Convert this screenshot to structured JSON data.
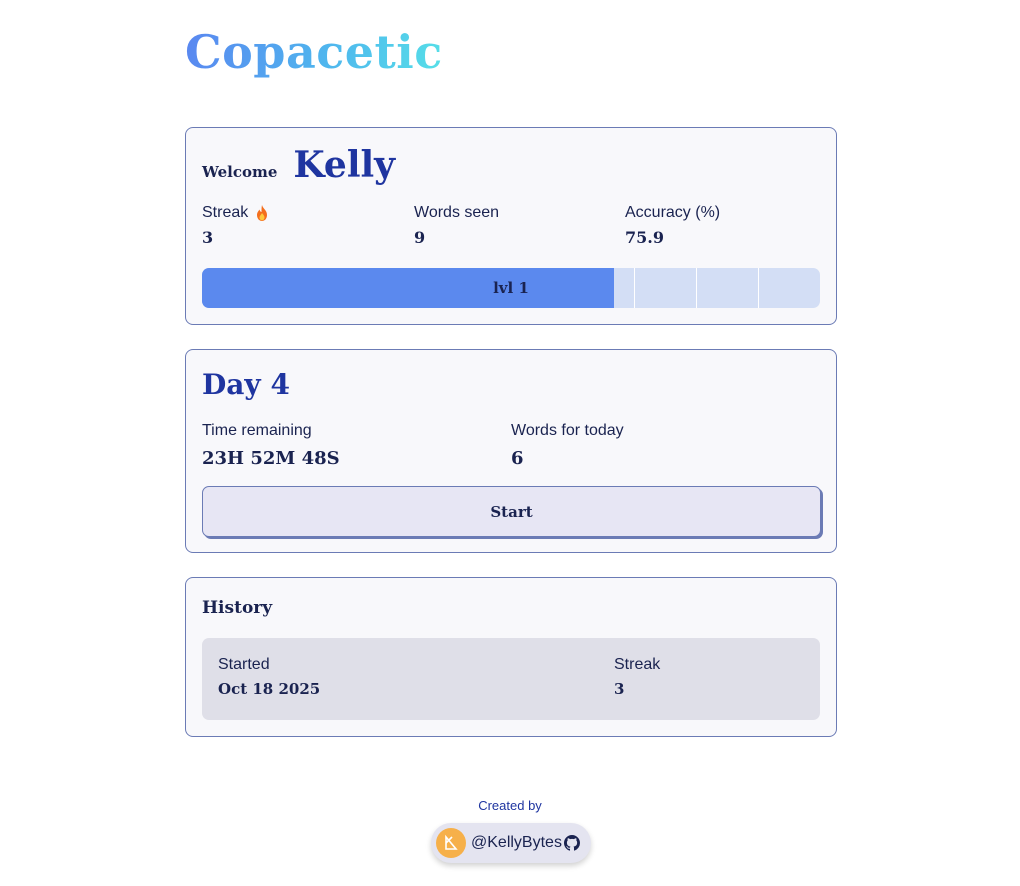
{
  "app": {
    "title": "Copacetic"
  },
  "welcome": {
    "label": "Welcome",
    "name": "Kelly"
  },
  "stats": {
    "streak_label": "Streak",
    "streak_value": "3",
    "words_seen_label": "Words seen",
    "words_seen_value": "9",
    "accuracy_label": "Accuracy (%)",
    "accuracy_value": "75.9"
  },
  "level": {
    "label": "lvl 1",
    "progress": 0.667
  },
  "day": {
    "title": "Day 4",
    "time_label": "Time remaining",
    "time_value": "23H 52M 48S",
    "words_label": "Words for today",
    "words_value": "6",
    "start_label": "Start"
  },
  "history": {
    "title": "History",
    "started_label": "Started",
    "started_value": "Oct 18 2025",
    "streak_label": "Streak",
    "streak_value": "3"
  },
  "footer": {
    "created_by": "Created by",
    "author": "@KellyBytes"
  },
  "colors": {
    "accent": "#1f35a0",
    "level_fill": "#5b89ee",
    "level_track": "#d3def5",
    "card_border": "#6b7bb5",
    "avatar": "#f6b04a"
  },
  "icons": {
    "streak": "flame-icon",
    "author": "avatar-icon",
    "github": "github-icon"
  }
}
